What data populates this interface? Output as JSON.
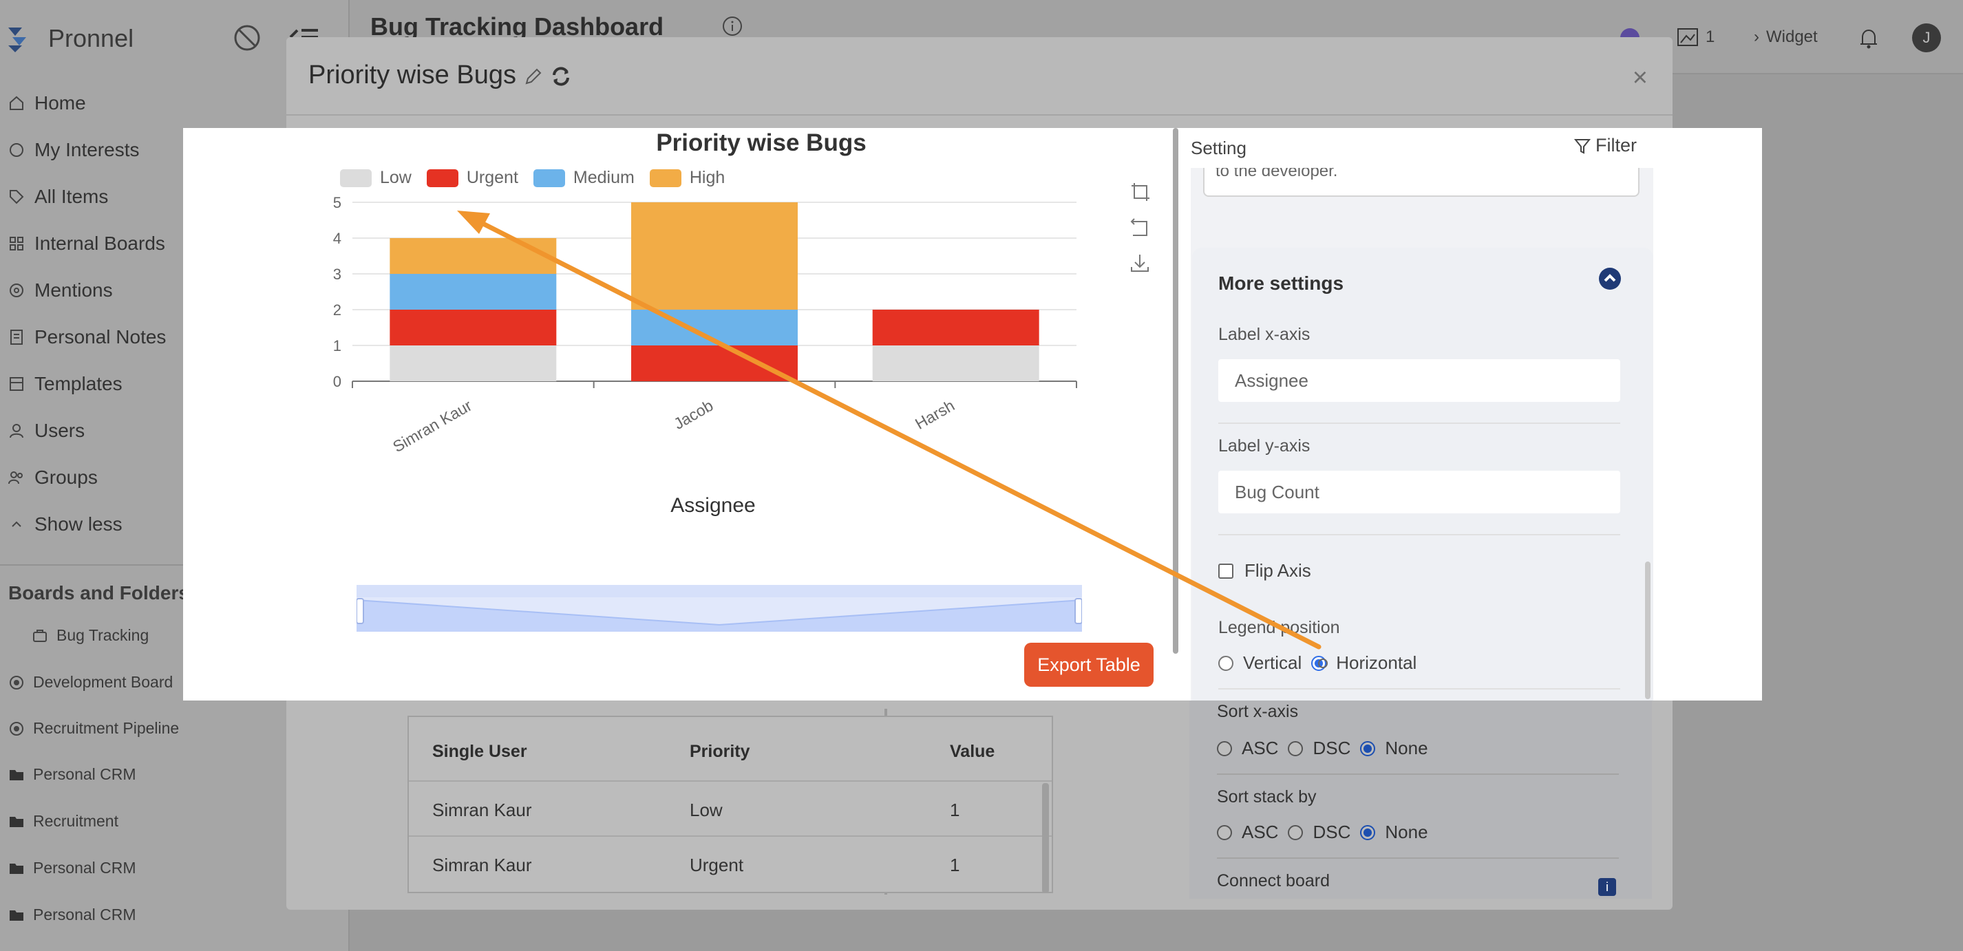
{
  "app": {
    "brand": "Pronnel",
    "page_title": "Bug Tracking Dashboard",
    "topbar": {
      "count": "1",
      "widget_label": "Widget",
      "avatar_initial": "J"
    },
    "nav": [
      "Home",
      "My Interests",
      "All Items",
      "Internal Boards",
      "Mentions",
      "Personal Notes",
      "Templates",
      "Users",
      "Groups",
      "Show less"
    ],
    "boards_title": "Boards and Folders",
    "boards": [
      "Bug Tracking",
      "Development Board",
      "Recruitment Pipeline",
      "Personal CRM",
      "Recruitment",
      "Personal CRM",
      "Personal CRM"
    ]
  },
  "modal": {
    "title": "Priority wise Bugs",
    "close": "×",
    "export_label": "Export Table",
    "settings_label": "Setting",
    "filter_label": "Filter",
    "textarea_tail": "to the developer.",
    "more_settings": "More settings",
    "label_x": "Label x-axis",
    "label_x_value": "Assignee",
    "label_y": "Label y-axis",
    "label_y_value": "Bug Count",
    "flip_axis": "Flip Axis",
    "legend_position": "Legend position",
    "legend_vertical": "Vertical",
    "legend_horizontal": "Horizontal",
    "sort_x": "Sort x-axis",
    "sort_stack": "Sort stack by",
    "asc": "ASC",
    "dsc": "DSC",
    "none": "None",
    "connect_board": "Connect board",
    "info": "i"
  },
  "table": {
    "headers": [
      "Single User",
      "Priority",
      "Value"
    ],
    "rows": [
      [
        "Simran Kaur",
        "Low",
        "1"
      ],
      [
        "Simran Kaur",
        "Urgent",
        "1"
      ]
    ]
  },
  "colors": {
    "low": "#dcdcdc",
    "urgent": "#e53223",
    "medium": "#6cb3ea",
    "high": "#f2ac46",
    "export": "#e5552d",
    "arrow": "#f0952d"
  },
  "chart_data": {
    "type": "bar",
    "title": "Priority wise Bugs",
    "xlabel": "Assignee",
    "ylabel": "",
    "categories": [
      "Simran Kaur",
      "Jacob",
      "Harsh"
    ],
    "series": [
      {
        "name": "Low",
        "values": [
          1,
          0,
          1
        ]
      },
      {
        "name": "Urgent",
        "values": [
          1,
          1,
          1
        ]
      },
      {
        "name": "Medium",
        "values": [
          1,
          1,
          0
        ]
      },
      {
        "name": "High",
        "values": [
          1,
          3,
          0
        ]
      }
    ],
    "stacked": true,
    "ylim": [
      0,
      5
    ],
    "yticks": [
      0,
      1,
      2,
      3,
      4,
      5
    ],
    "grid": true,
    "legend": "top-left"
  }
}
